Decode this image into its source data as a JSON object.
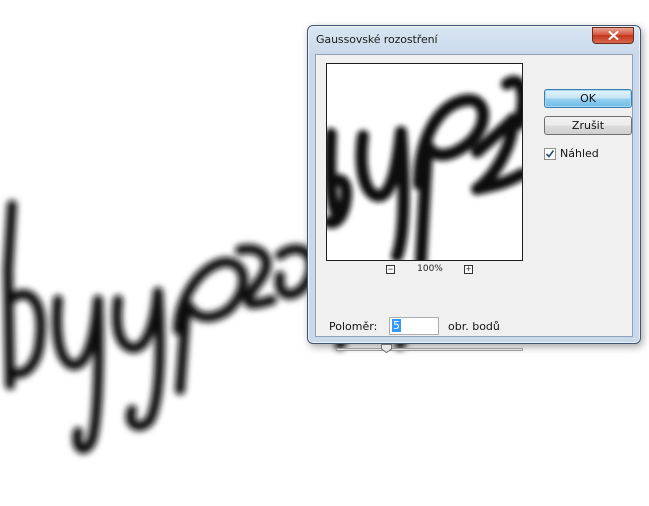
{
  "dialog": {
    "title": "Gaussovské rozostření",
    "ok_label": "OK",
    "cancel_label": "Zrušit",
    "preview_checkbox": {
      "label": "Náhled",
      "checked": true
    },
    "zoom": {
      "value": "100%",
      "minus": "−",
      "plus": "+"
    },
    "radius": {
      "label": "Poloměr:",
      "value": "5",
      "unit": "obr. bodů",
      "slider_fraction": 0.27
    }
  },
  "colors": {
    "accent": "#3399ff",
    "close_button": "#c3361c",
    "titlebar": "#c9d9ea"
  },
  "icons": {
    "close": "close-icon",
    "checkmark": "checkmark-icon"
  }
}
